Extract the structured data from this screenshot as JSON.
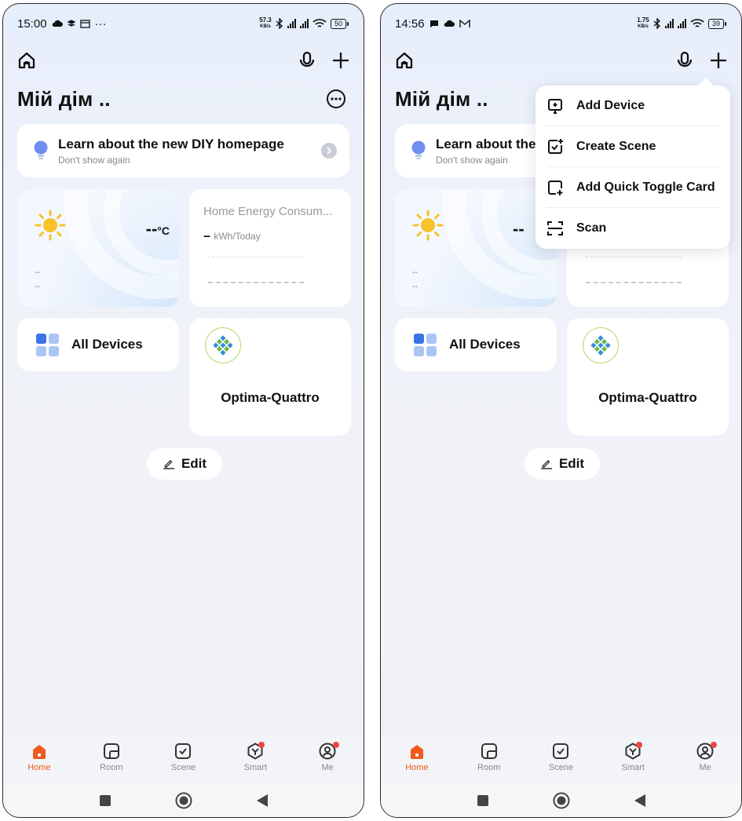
{
  "left": {
    "status": {
      "time": "15:00",
      "net_speed_top": "57.3",
      "net_speed_unit": "KB/s",
      "battery": "50"
    },
    "home_title": "Мій дім ..",
    "banner": {
      "title": "Learn about the new DIY homepage",
      "subtitle": "Don't show again"
    },
    "weather": {
      "temp": "--",
      "unit": "°C",
      "line1": "--",
      "line2": "--"
    },
    "energy": {
      "title": "Home Energy Consum...",
      "value": "--",
      "unit": "kWh/Today"
    },
    "all_devices": "All Devices",
    "device": "Optima-Quattro",
    "edit": "Edit"
  },
  "right": {
    "status": {
      "time": "14:56",
      "net_speed_top": "1.75",
      "net_speed_unit": "KB/s",
      "battery": "39"
    },
    "home_title": "Мій дім ..",
    "banner": {
      "title": "Learn about the",
      "subtitle": "Don't show again"
    },
    "weather": {
      "temp": "--",
      "line1": "--",
      "line2": "--"
    },
    "all_devices": "All Devices",
    "device": "Optima-Quattro",
    "edit": "Edit",
    "menu": [
      "Add Device",
      "Create Scene",
      "Add Quick Toggle Card",
      "Scan"
    ]
  },
  "tabs": [
    "Home",
    "Room",
    "Scene",
    "Smart",
    "Me"
  ],
  "accent": "#f05a1e",
  "badge_color": "#f04444"
}
